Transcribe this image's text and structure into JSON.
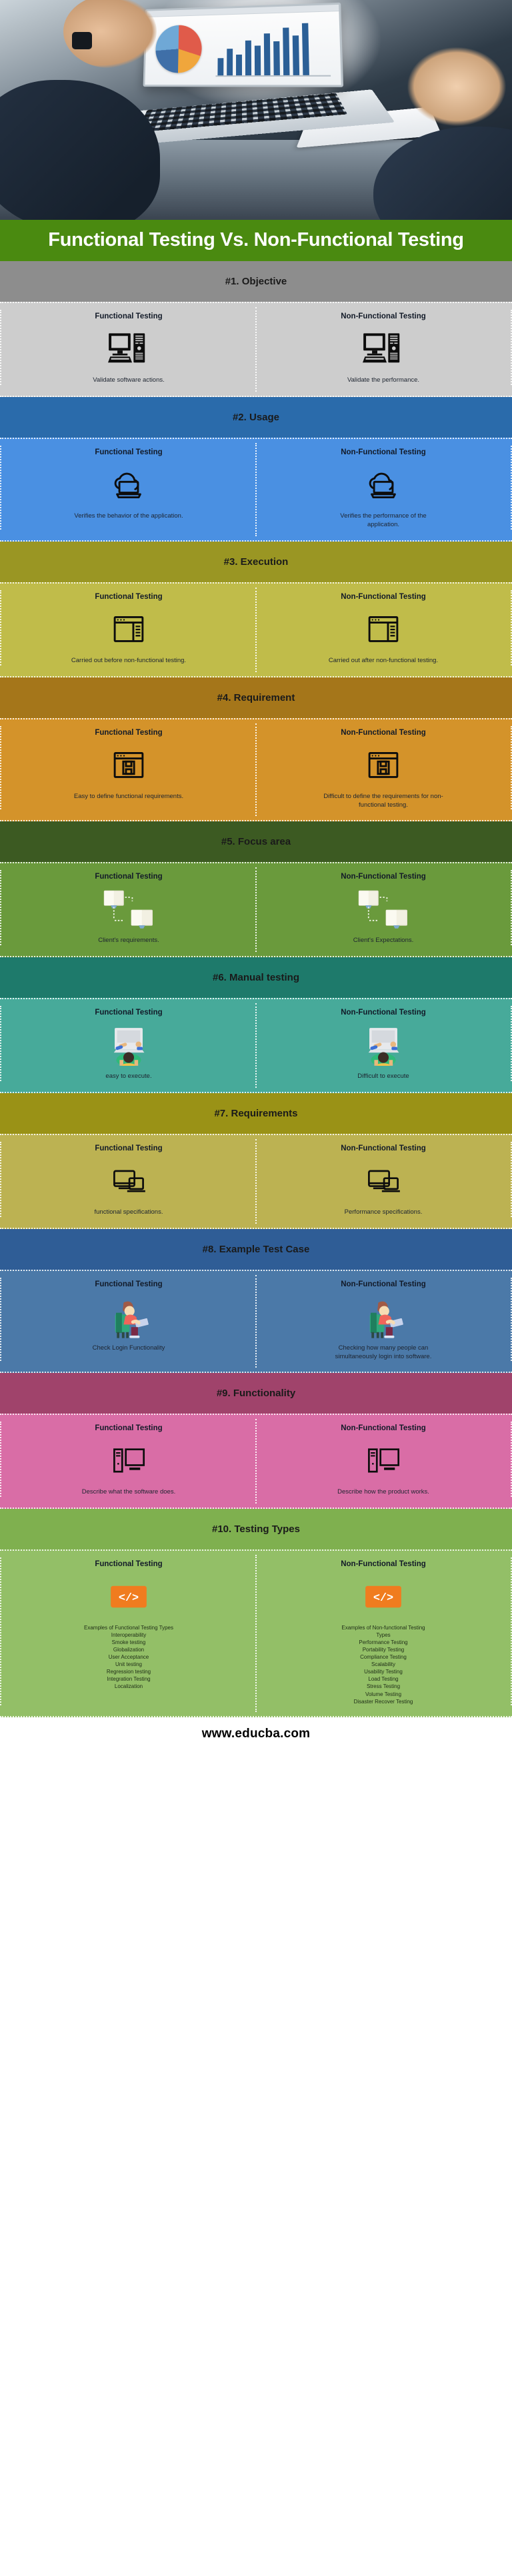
{
  "title": "Functional Testing Vs. Non-Functional Testing",
  "footer": {
    "url": "www.educba.com"
  },
  "labels": {
    "functional": "Functional Testing",
    "non_functional": "Non-Functional Testing"
  },
  "sections": [
    {
      "header": "#1. Objective",
      "header_bg": "#8d8d8d",
      "body_bg": "#cdcdcd",
      "left": {
        "title": "Functional Testing",
        "icon": "desktop-computer-icon",
        "desc": "Validate software actions."
      },
      "right": {
        "title": "Non-Functional Testing",
        "icon": "desktop-computer-icon",
        "desc": "Validate the performance."
      }
    },
    {
      "header": "#2. Usage",
      "header_bg": "#2a6bab",
      "body_bg": "#4a90e2",
      "left": {
        "title": "Functional Testing",
        "icon": "cloud-laptop-icon",
        "desc": "Verifies the behavior of the application."
      },
      "right": {
        "title": "Non-Functional Testing",
        "icon": "cloud-laptop-icon",
        "desc": "Verifies the performance of the application."
      }
    },
    {
      "header": "#3. Execution",
      "header_bg": "#9a9623",
      "body_bg": "#c0bc4a",
      "left": {
        "title": "Functional Testing",
        "icon": "browser-window-icon",
        "desc": "Carried out before non-functional testing."
      },
      "right": {
        "title": "Non-Functional Testing",
        "icon": "browser-window-icon",
        "desc": "Carried out after non-functional testing."
      }
    },
    {
      "header": "#4. Requirement",
      "header_bg": "#a5761a",
      "body_bg": "#d4932a",
      "left": {
        "title": "Functional Testing",
        "icon": "browser-save-icon",
        "desc": "Easy to define functional requirements."
      },
      "right": {
        "title": "Non-Functional Testing",
        "icon": "browser-save-icon",
        "desc": "Difficult to define the requirements for non-functional testing."
      }
    },
    {
      "header": "#5. Focus area",
      "header_bg": "#3c5a22",
      "body_bg": "#6a9a3c",
      "left": {
        "title": "Functional Testing",
        "icon": "two-monitors-icon",
        "desc": "Client's requirements."
      },
      "right": {
        "title": "Non-Functional Testing",
        "icon": "two-monitors-icon",
        "desc": "Client's Expectations."
      }
    },
    {
      "header": "#6. Manual testing",
      "header_bg": "#1e7a6b",
      "body_bg": "#47aa9a",
      "left": {
        "title": "Functional Testing",
        "icon": "person-at-laptop-icon",
        "desc": "easy to execute."
      },
      "right": {
        "title": "Non-Functional Testing",
        "icon": "person-at-laptop-icon",
        "desc": "Difficult to execute"
      }
    },
    {
      "header": "#7. Requirements",
      "header_bg": "#9a9216",
      "body_bg": "#bcb252",
      "left": {
        "title": "Functional Testing",
        "icon": "devices-icon",
        "desc": "functional specifications."
      },
      "right": {
        "title": "Non-Functional Testing",
        "icon": "devices-icon",
        "desc": "Performance specifications."
      }
    },
    {
      "header": "#8. Example Test Case",
      "header_bg": "#2f5d96",
      "body_bg": "#4b79a8",
      "left": {
        "title": "Functional Testing",
        "icon": "person-working-icon",
        "desc": "Check Login Functionality"
      },
      "right": {
        "title": "Non-Functional Testing",
        "icon": "person-working-icon",
        "desc": "Checking how many people can simultaneously login into software."
      }
    },
    {
      "header": "#9. Functionality",
      "header_bg": "#a0436b",
      "body_bg": "#d96da6",
      "left": {
        "title": "Functional Testing",
        "icon": "tower-monitor-icon",
        "desc": "Describe what the software does."
      },
      "right": {
        "title": "Non-Functional Testing",
        "icon": "tower-monitor-icon",
        "desc": "Describe how the product works."
      }
    },
    {
      "header": "#10. Testing Types",
      "header_bg": "#7fb04f",
      "body_bg": "#93bf67",
      "left": {
        "title": "Functional Testing",
        "icon": "code-badge-icon",
        "list": [
          "Examples of Functional Testing Types",
          "Interoperability",
          "Smoke testing",
          "Globalization",
          "User Acceptance",
          "Unit testing",
          "Regression testing",
          "Integration Testing",
          "Localization"
        ]
      },
      "right": {
        "title": "Non-Functional Testing",
        "icon": "code-badge-icon",
        "list": [
          "Examples of Non-functional Testing",
          "Types",
          "Performance Testing",
          "Portability Testing",
          "Compliance Testing",
          "Scalability",
          "Usability Testing",
          "Load Testing",
          "Stress Testing",
          "Volume Testing",
          "Disaster Recover Testing"
        ]
      }
    }
  ]
}
